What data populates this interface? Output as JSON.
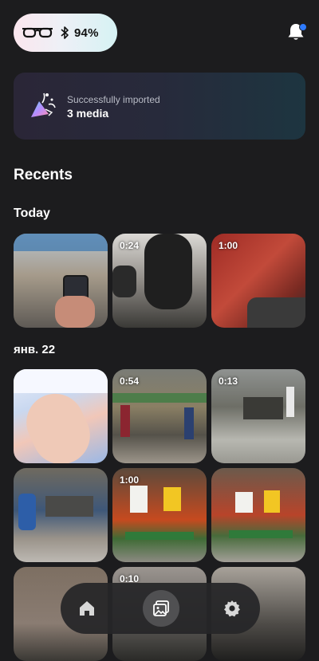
{
  "status": {
    "battery": "94%"
  },
  "banner": {
    "subtitle": "Successfully imported",
    "title": "3 media"
  },
  "sections": {
    "recents": "Recents",
    "today": "Today",
    "date": "янв. 22"
  },
  "thumbs": {
    "t2_duration": "0:24",
    "t3_duration": "1:00",
    "t5_duration": "0:54",
    "t6_duration": "0:13",
    "t8_duration": "1:00",
    "t11_duration": "0:10"
  },
  "icons": {
    "status": [
      "glasses-icon",
      "bluetooth-icon"
    ],
    "header": [
      "bell-icon"
    ],
    "banner": [
      "import-icon"
    ],
    "nav": [
      "home-icon",
      "gallery-icon",
      "settings-icon"
    ]
  },
  "colors": {
    "accent_dot": "#2e7bff",
    "background": "#1c1c1e"
  }
}
